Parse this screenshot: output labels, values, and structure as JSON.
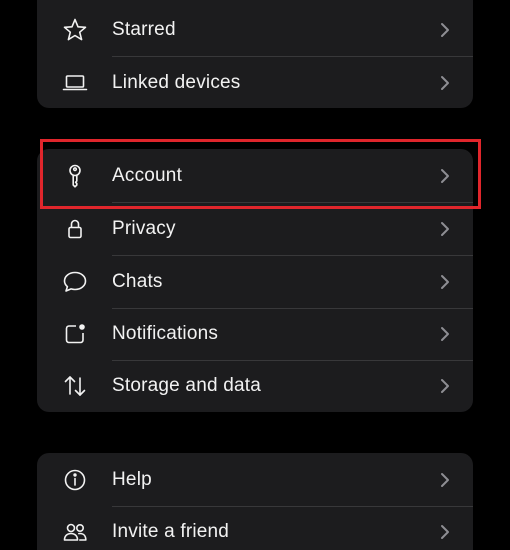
{
  "settings": {
    "group1": {
      "starred_label": "Starred",
      "linked_devices_label": "Linked devices"
    },
    "group2": {
      "account_label": "Account",
      "privacy_label": "Privacy",
      "chats_label": "Chats",
      "notifications_label": "Notifications",
      "storage_label": "Storage and data"
    },
    "group3": {
      "help_label": "Help",
      "invite_label": "Invite a friend"
    }
  },
  "icons": {
    "starred": "star-icon",
    "linked_devices": "laptop-icon",
    "account": "key-icon",
    "privacy": "lock-icon",
    "chats": "chat-bubble-icon",
    "notifications": "notification-badge-icon",
    "storage": "arrows-up-down-icon",
    "help": "info-icon",
    "invite": "people-icon",
    "chevron": "chevron-right-icon"
  },
  "colors": {
    "background": "#000000",
    "group_background": "#1c1c1e",
    "text": "#f2f2f2",
    "divider": "#38383a",
    "chevron": "#8e8e93",
    "highlight_border": "#e0262c"
  }
}
